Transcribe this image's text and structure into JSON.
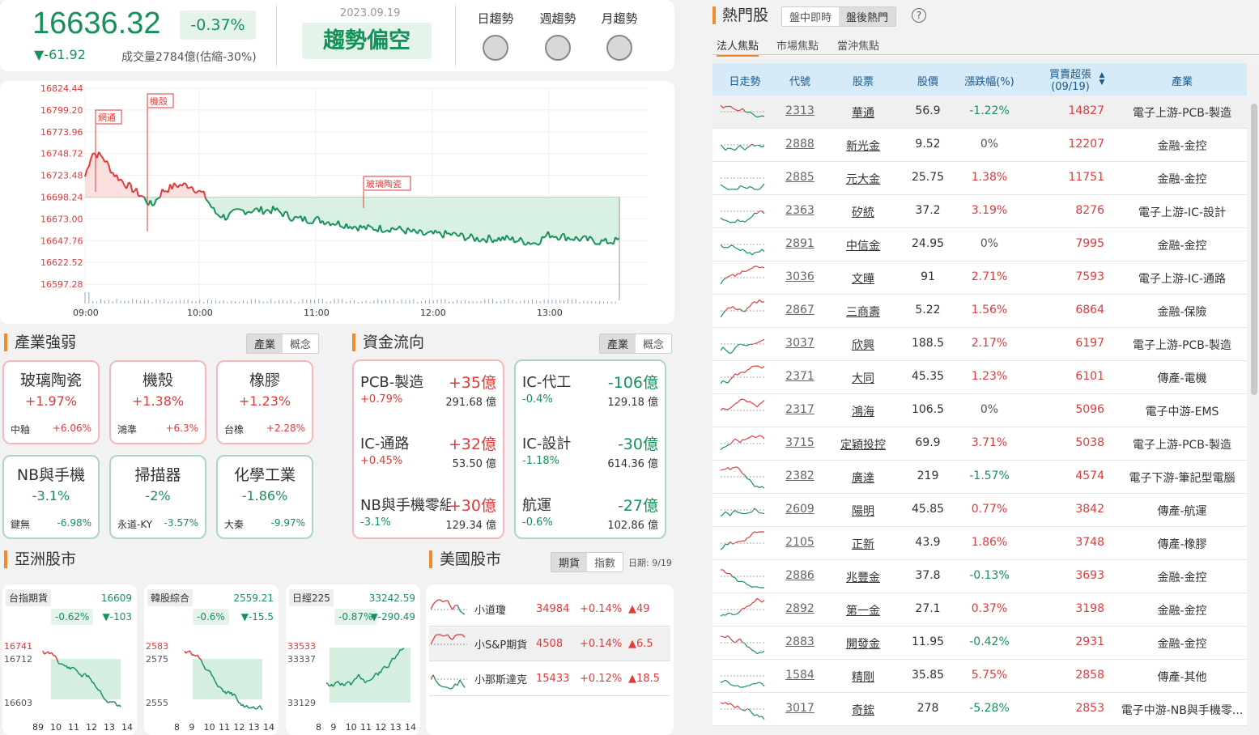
{
  "index": {
    "price": "16636.32",
    "pct": "-0.37%",
    "change": "▼-61.92",
    "volume": "成交量2784億(估縮-30%)",
    "date": "2023.09.19",
    "trend": "趨勢偏空"
  },
  "trend_cells": [
    {
      "label": "日趨勢"
    },
    {
      "label": "週趨勢"
    },
    {
      "label": "月趨勢"
    }
  ],
  "main_chart": {
    "y_ticks": [
      "16824.44",
      "16799.20",
      "16773.96",
      "16748.72",
      "16723.48",
      "16698.24",
      "16673.00",
      "16647.76",
      "16622.52",
      "16597.28"
    ],
    "x_ticks": [
      "09:00",
      "10:00",
      "11:00",
      "12:00",
      "13:00"
    ],
    "annotations": [
      "網通",
      "機殼",
      "玻璃陶瓷"
    ],
    "reference": 16698.24
  },
  "industry": {
    "title": "產業強弱",
    "tabs": [
      "產業",
      "概念"
    ],
    "items": [
      {
        "name": "玻璃陶瓷",
        "pct": "+1.97%",
        "stock": "中釉",
        "stock_pct": "+6.06%",
        "dir": "up"
      },
      {
        "name": "機殼",
        "pct": "+1.38%",
        "stock": "鴻準",
        "stock_pct": "+6.3%",
        "dir": "up"
      },
      {
        "name": "橡膠",
        "pct": "+1.23%",
        "stock": "台橡",
        "stock_pct": "+2.28%",
        "dir": "up"
      },
      {
        "name": "NB與手機",
        "pct": "-3.1%",
        "stock": "鍵無",
        "stock_pct": "-6.98%",
        "dir": "dn"
      },
      {
        "name": "掃描器",
        "pct": "-2%",
        "stock": "永道-KY",
        "stock_pct": "-3.57%",
        "dir": "dn"
      },
      {
        "name": "化學工業",
        "pct": "-1.86%",
        "stock": "大秦",
        "stock_pct": "-9.97%",
        "dir": "dn"
      }
    ]
  },
  "flow": {
    "title": "資金流向",
    "tabs": [
      "產業",
      "概念"
    ],
    "inflow": [
      {
        "name": "PCB-製造",
        "amount": "+35億",
        "pct": "+0.79%",
        "vol": "291.68 億"
      },
      {
        "name": "IC-通路",
        "amount": "+32億",
        "pct": "+0.45%",
        "vol": "53.50 億"
      },
      {
        "name": "NB與手機零組件",
        "amount": "+30億",
        "pct": "-3.1%",
        "vol": "129.34 億"
      }
    ],
    "outflow": [
      {
        "name": "IC-代工",
        "amount": "-106億",
        "pct": "-0.4%",
        "vol": "129.18 億"
      },
      {
        "name": "IC-設計",
        "amount": "-30億",
        "pct": "-1.18%",
        "vol": "614.36 億"
      },
      {
        "name": "航運",
        "amount": "-27億",
        "pct": "-0.6%",
        "vol": "102.86 億"
      }
    ]
  },
  "asia": {
    "title": "亞洲股市",
    "markets": [
      {
        "name": "台指期貨",
        "last": "16609",
        "pct": "-0.62%",
        "chg": "▼-103",
        "y_ticks": [
          "16741",
          "16712",
          "16603"
        ],
        "x_ticks": [
          "89",
          "10",
          "11",
          "12",
          "13",
          "14"
        ]
      },
      {
        "name": "韓股綜合",
        "last": "2559.21",
        "pct": "-0.6%",
        "chg": "▼-15.5",
        "y_ticks": [
          "2583",
          "2575",
          "2555"
        ],
        "x_ticks": [
          "8",
          "9",
          "10",
          "11",
          "12",
          "13",
          "14"
        ]
      },
      {
        "name": "日經225",
        "last": "33242.59",
        "pct": "-0.87%",
        "chg": "▼-290.49",
        "y_ticks": [
          "33533",
          "33337",
          "33129"
        ],
        "x_ticks": [
          "8",
          "9",
          "10",
          "11",
          "12",
          "13",
          "14"
        ]
      }
    ]
  },
  "us": {
    "title": "美國股市",
    "tabs": [
      "期貨",
      "指數"
    ],
    "date": "日期: 9/19",
    "rows": [
      {
        "name": "小道瓊",
        "value": "34984",
        "pct": "+0.14%",
        "chg": "▲49"
      },
      {
        "name": "小S&P期貨",
        "value": "4508",
        "pct": "+0.14%",
        "chg": "▲6.5"
      },
      {
        "name": "小那斯達克",
        "value": "15433",
        "pct": "+0.12%",
        "chg": "▲18.5"
      }
    ]
  },
  "hot": {
    "title": "熱門股",
    "tabs": [
      "盤中即時",
      "盤後熱門"
    ],
    "help": "?",
    "subtabs": [
      "法人焦點",
      "市場焦點",
      "當沖焦點"
    ],
    "headers": [
      "日走勢",
      "代號",
      "股票",
      "股價",
      "漲跌幅(%)",
      "買賣超張",
      "(09/19)",
      "產業"
    ],
    "sort_icon": "▲▼",
    "rows": [
      {
        "code": "2313",
        "name": "華通",
        "price": "56.9",
        "pct": "-1.22%",
        "amt": "14827",
        "industry": "電子上游-PCB-製造",
        "dir": "dn"
      },
      {
        "code": "2888",
        "name": "新光金",
        "price": "9.52",
        "pct": "0%",
        "amt": "12207",
        "industry": "金融-金控",
        "dir": "flat"
      },
      {
        "code": "2885",
        "name": "元大金",
        "price": "25.75",
        "pct": "1.38%",
        "amt": "11751",
        "industry": "金融-金控",
        "dir": "up"
      },
      {
        "code": "2363",
        "name": "矽統",
        "price": "37.2",
        "pct": "3.19%",
        "amt": "8276",
        "industry": "電子上游-IC-設計",
        "dir": "up"
      },
      {
        "code": "2891",
        "name": "中信金",
        "price": "24.95",
        "pct": "0%",
        "amt": "7995",
        "industry": "金融-金控",
        "dir": "flat"
      },
      {
        "code": "3036",
        "name": "文曄",
        "price": "91",
        "pct": "2.71%",
        "amt": "7593",
        "industry": "電子上游-IC-通路",
        "dir": "up"
      },
      {
        "code": "2867",
        "name": "三商壽",
        "price": "5.22",
        "pct": "1.56%",
        "amt": "6864",
        "industry": "金融-保險",
        "dir": "up"
      },
      {
        "code": "3037",
        "name": "欣興",
        "price": "188.5",
        "pct": "2.17%",
        "amt": "6197",
        "industry": "電子上游-PCB-製造",
        "dir": "up"
      },
      {
        "code": "2371",
        "name": "大同",
        "price": "45.35",
        "pct": "1.23%",
        "amt": "6101",
        "industry": "傳產-電機",
        "dir": "up"
      },
      {
        "code": "2317",
        "name": "鴻海",
        "price": "106.5",
        "pct": "0%",
        "amt": "5096",
        "industry": "電子中游-EMS",
        "dir": "flat"
      },
      {
        "code": "3715",
        "name": "定穎投控",
        "price": "69.9",
        "pct": "3.71%",
        "amt": "5038",
        "industry": "電子上游-PCB-製造",
        "dir": "up"
      },
      {
        "code": "2382",
        "name": "廣達",
        "price": "219",
        "pct": "-1.57%",
        "amt": "4574",
        "industry": "電子下游-筆記型電腦",
        "dir": "dn"
      },
      {
        "code": "2609",
        "name": "陽明",
        "price": "45.85",
        "pct": "0.77%",
        "amt": "3842",
        "industry": "傳產-航運",
        "dir": "up"
      },
      {
        "code": "2105",
        "name": "正新",
        "price": "43.9",
        "pct": "1.86%",
        "amt": "3748",
        "industry": "傳產-橡膠",
        "dir": "up"
      },
      {
        "code": "2886",
        "name": "兆豐金",
        "price": "37.8",
        "pct": "-0.13%",
        "amt": "3693",
        "industry": "金融-金控",
        "dir": "dn"
      },
      {
        "code": "2892",
        "name": "第一金",
        "price": "27.1",
        "pct": "0.37%",
        "amt": "3198",
        "industry": "金融-金控",
        "dir": "up"
      },
      {
        "code": "2883",
        "name": "開發金",
        "price": "11.95",
        "pct": "-0.42%",
        "amt": "2931",
        "industry": "金融-金控",
        "dir": "dn"
      },
      {
        "code": "1584",
        "name": "精剛",
        "price": "35.85",
        "pct": "5.75%",
        "amt": "2858",
        "industry": "傳產-其他",
        "dir": "up"
      },
      {
        "code": "3017",
        "name": "奇鋐",
        "price": "278",
        "pct": "-5.28%",
        "amt": "2853",
        "industry": "電子中游-NB與手機零...",
        "dir": "dn"
      }
    ]
  },
  "colors": {
    "up": "#e03a3a",
    "down": "#16915a",
    "accent": "#f08a2c",
    "header_bg": "#d6eaf8"
  }
}
